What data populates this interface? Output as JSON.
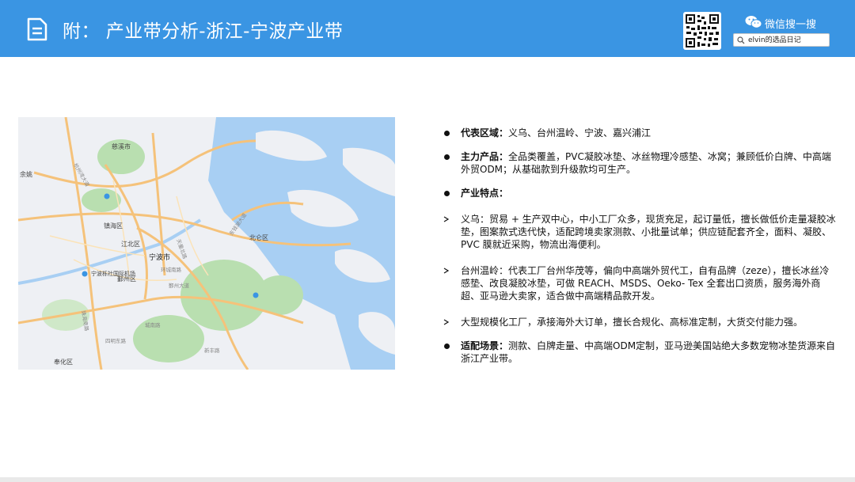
{
  "header": {
    "title": "附：  产业带分析-浙江-宁波产业带",
    "wechat_label": "微信搜一搜",
    "search_value": "elvin的选品日记"
  },
  "map": {
    "labels": {
      "north_lun": "北仑区",
      "zhen_hai": "镇海区",
      "jiang_bei": "江北区",
      "ningbo": "宁波市",
      "yin_zhou": "鄞州区",
      "feng_hua": "奉化区",
      "yu_yao": "余姚",
      "ci_xi": "慈溪市",
      "airport": "宁波栎社国际机场"
    },
    "road_labels": {
      "hangzhou_bay": "杭州湾大道",
      "huancheng": "环城南路",
      "tiantong": "天童北路",
      "siming": "四明东路",
      "zhuhai": "珠海南路",
      "daoliu": "东钱湖大道",
      "xinfeng": "新丰路",
      "chenglin": "城南路",
      "xianning": "鄞州大道"
    }
  },
  "content": {
    "items": [
      {
        "type": "dot",
        "label": "代表区域：",
        "text": "义乌、台州温岭、宁波、嘉兴浦江"
      },
      {
        "type": "dot",
        "label": "主力产品：",
        "text": "全品类覆盖，PVC凝胶冰垫、冰丝物理冷感垫、冰窝；兼顾低价白牌、中高端外贸ODM；从基础款到升级款均可生产。"
      },
      {
        "type": "dot",
        "label": "产业特点：",
        "text": ""
      },
      {
        "type": "arrow",
        "label": "",
        "text": "义乌：贸易 + 生产双中心，中小工厂众多，现货充足，起订量低，擅长做低价走量凝胶冰垫，图案款式迭代快，适配跨境卖家测款、小批量试单；供应链配套齐全，面料、凝胶、PVC 膜就近采购，物流出海便利。"
      },
      {
        "type": "arrow",
        "label": "",
        "text": "台州温岭：代表工厂台州华茂等，偏向中高端外贸代工，自有品牌（zeze），擅长冰丝冷感垫、改良凝胶冰垫，可做 REACH、MSDS、Oeko-  Tex 全套出口资质，服务海外商超、亚马逊大卖家，适合做中高端精品款开发。"
      },
      {
        "type": "arrow",
        "label": "",
        "text": "大型规模化工厂，承接海外大订单，擅长合规化、高标准定制，大货交付能力强。"
      },
      {
        "type": "dot",
        "label": "适配场景：",
        "text": "测款、白牌走量、中高端ODM定制，亚马逊美国站绝大多数宠物冰垫货源来自浙江产业带。"
      }
    ]
  },
  "colors": {
    "header_bg": "#3a95e3",
    "sea": "#a8cff3",
    "land": "#eef0f4",
    "park": "#b9dfb0",
    "road": "#f5c27a"
  }
}
